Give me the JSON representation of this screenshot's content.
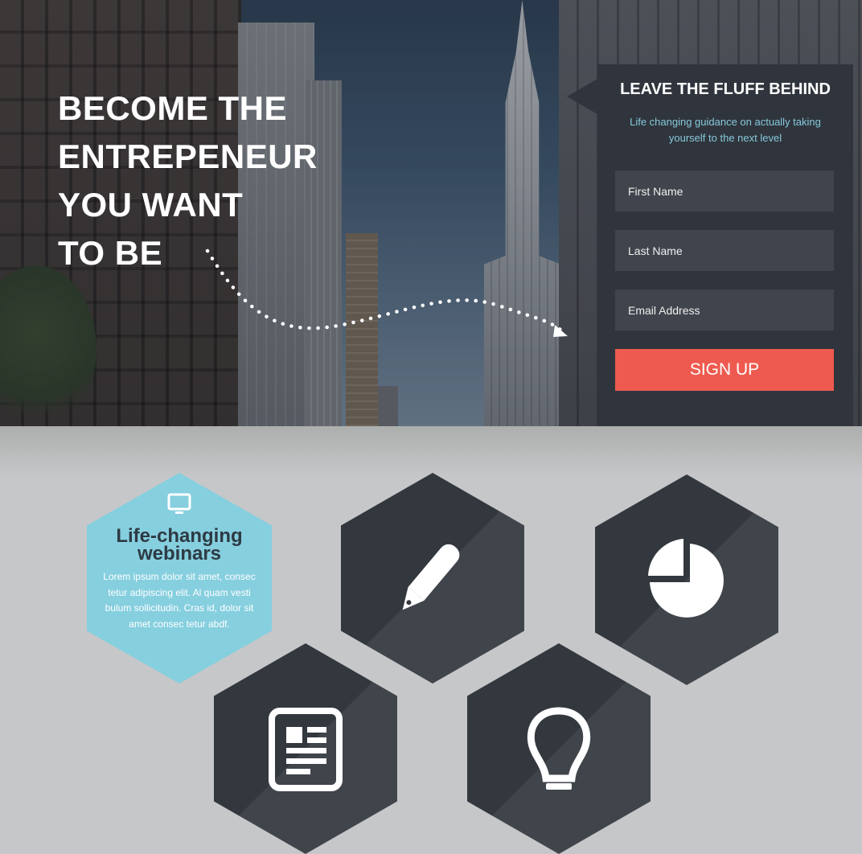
{
  "hero": {
    "title_lines": [
      "BECOME THE",
      "ENTREPENEUR",
      "YOU WANT",
      "TO BE"
    ]
  },
  "signup": {
    "title": "LEAVE THE FLUFF BEHIND",
    "subtitle": "Life changing guidance on actually taking yourself to the next level",
    "fields": {
      "first_name_placeholder": "First Name",
      "last_name_placeholder": "Last Name",
      "email_placeholder": "Email Address"
    },
    "button_label": "SIGN UP"
  },
  "features": {
    "webinar": {
      "icon": "monitor-icon",
      "title": "Life-changing webinars",
      "text": "Lorem ipsum dolor sit amet, consec tetur adipiscing elit. Al quam vesti bulum sollicitudin. Cras id, dolor sit amet consec tetur abdf."
    },
    "tiles": [
      {
        "icon": "pencil-icon"
      },
      {
        "icon": "pie-chart-icon"
      },
      {
        "icon": "newspaper-icon"
      },
      {
        "icon": "lightbulb-icon"
      }
    ]
  },
  "colors": {
    "accent_red": "#ee5a4f",
    "accent_blue": "#86cfdf",
    "panel_dark": "#30353d",
    "field_bg": "#40454d",
    "hex_dark": "#33373e",
    "background_gray": "#c6c7c9"
  }
}
